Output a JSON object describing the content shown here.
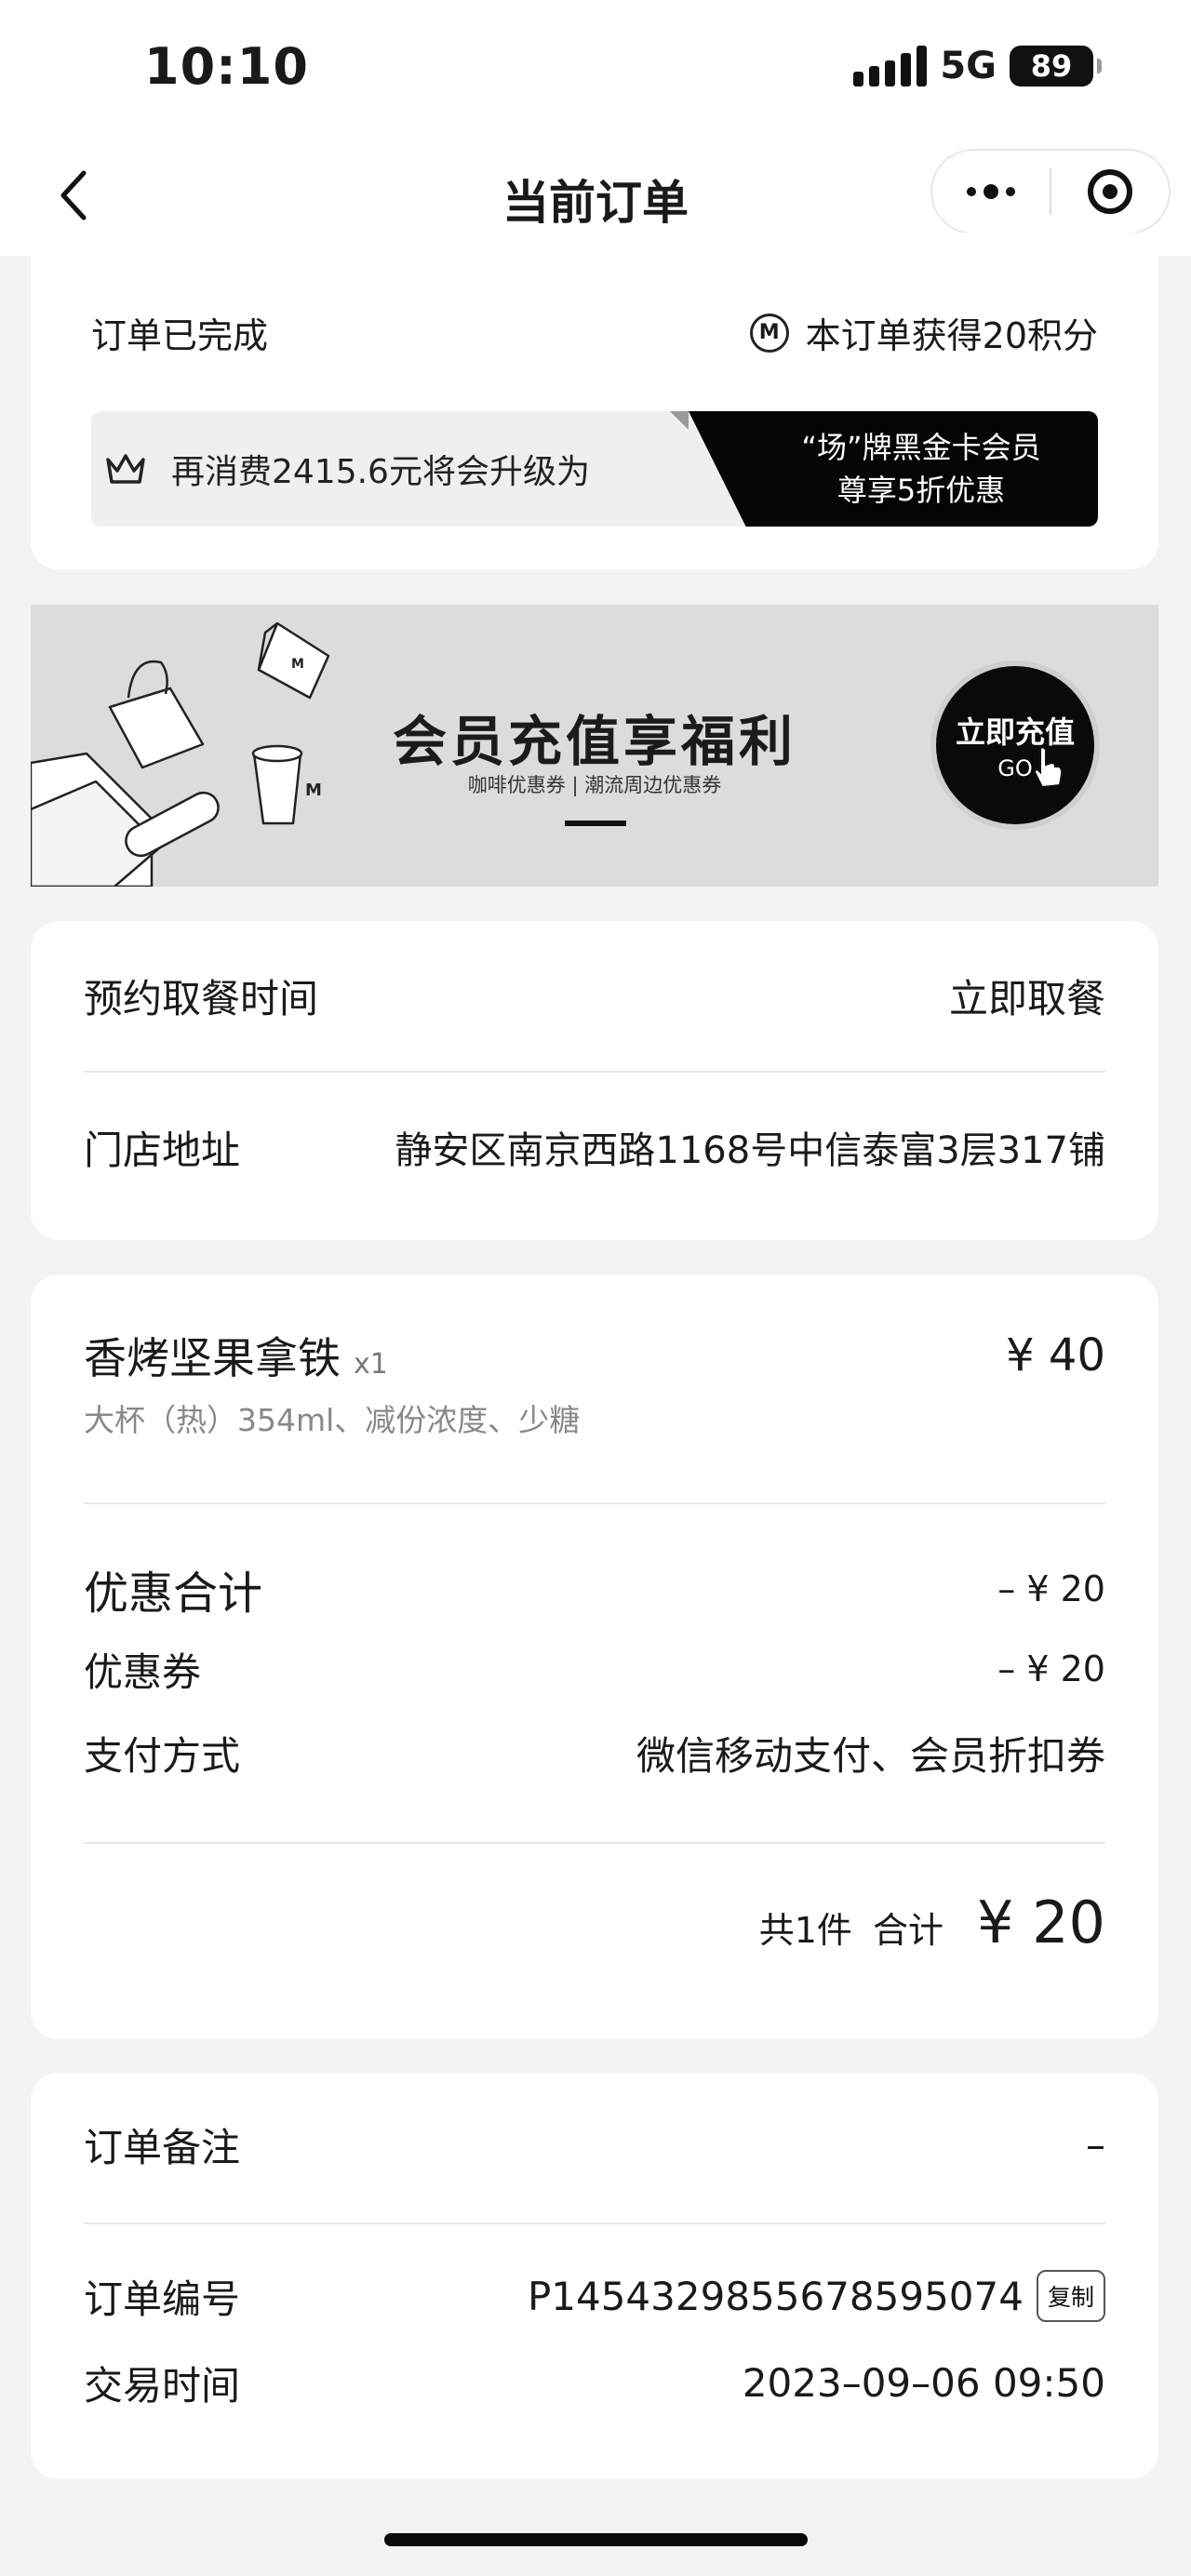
{
  "status_bar": {
    "time": "10:10",
    "network": "5G",
    "battery": "89"
  },
  "nav": {
    "title": "当前订单"
  },
  "order_status": {
    "status": "订单已完成",
    "points_text": "本订单获得20积分",
    "upgrade_text": "再消费2415.6元将会升级为",
    "upgrade_tier_line1": "“场”牌黑金卡会员",
    "upgrade_tier_line2": "尊享5折优惠"
  },
  "banner": {
    "title": "会员充值享福利",
    "subtitle": "咖啡优惠券 | 潮流周边优惠券",
    "button_label": "立即充值",
    "button_go": "GO"
  },
  "pickup": {
    "time_label": "预约取餐时间",
    "time_value": "立即取餐",
    "store_label": "门店地址",
    "store_value": "静安区南京西路1168号中信泰富3层317铺"
  },
  "item": {
    "name": "香烤坚果拿铁",
    "qty": "x1",
    "price": "¥ 40",
    "spec": "大杯（热）354ml、减份浓度、少糖"
  },
  "summary": {
    "discount_total_label": "优惠合计",
    "discount_total_value": "– ¥ 20",
    "coupon_label": "优惠券",
    "coupon_value": "– ¥ 20",
    "payment_label": "支付方式",
    "payment_value": "微信移动支付、会员折扣券",
    "count_text": "共1件",
    "total_label": "合计",
    "total_value": "¥ 20"
  },
  "order_info": {
    "note_label": "订单备注",
    "note_value": "–",
    "number_label": "订单编号",
    "number_value": "P1454329855678595074",
    "copy_label": "复制",
    "time_label": "交易时间",
    "time_value": "2023–09–06 09:50"
  }
}
